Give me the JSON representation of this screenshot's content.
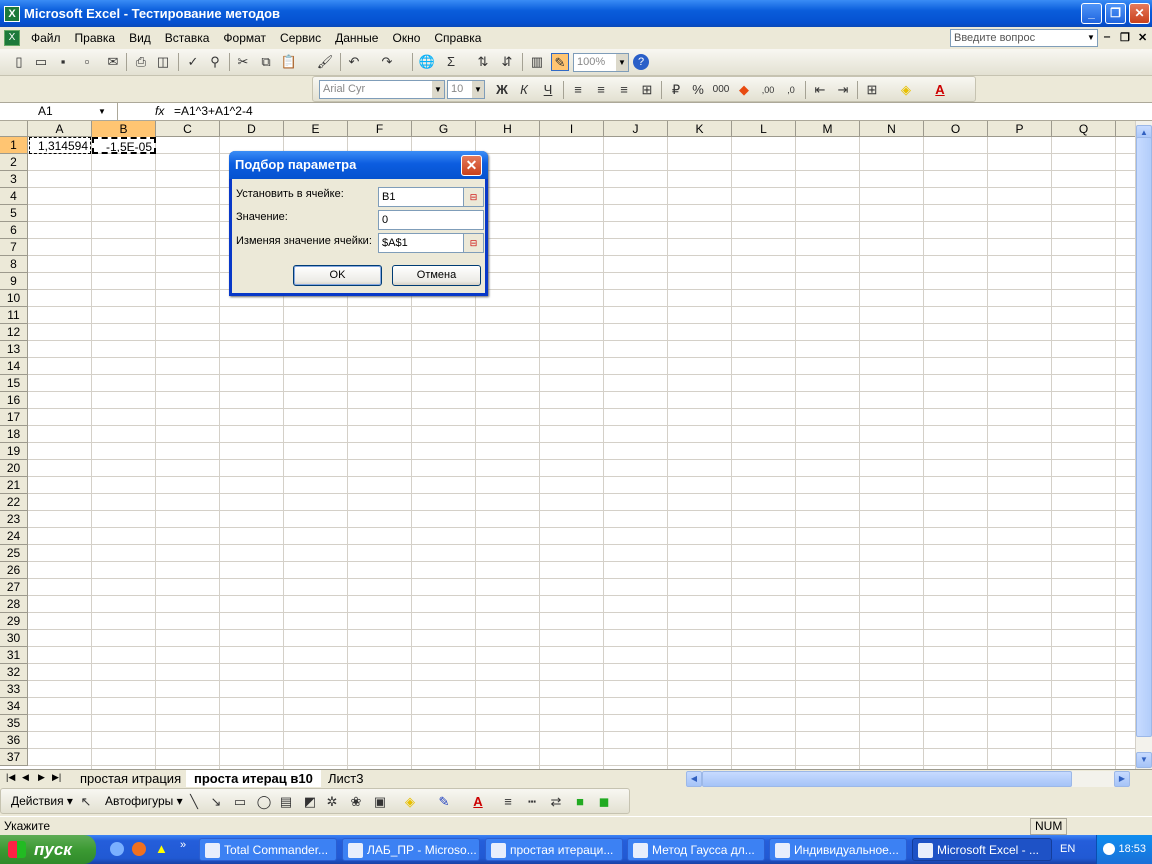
{
  "window": {
    "title": "Microsoft Excel - Тестирование методов"
  },
  "menu": {
    "items": [
      "Файл",
      "Правка",
      "Вид",
      "Вставка",
      "Формат",
      "Сервис",
      "Данные",
      "Окно",
      "Справка"
    ],
    "ask_placeholder": "Введите вопрос"
  },
  "toolbar": {
    "font": "Arial Cyr",
    "size": "10",
    "zoom": "100%"
  },
  "formula_bar": {
    "name_box": "A1",
    "fx": "fx",
    "formula": "=A1^3+A1^2-4"
  },
  "grid": {
    "columns": [
      "A",
      "B",
      "C",
      "D",
      "E",
      "F",
      "G",
      "H",
      "I",
      "J",
      "K",
      "L",
      "M",
      "N",
      "O",
      "P",
      "Q"
    ],
    "rows": [
      "1",
      "2",
      "3",
      "4",
      "5",
      "6",
      "7",
      "8",
      "9",
      "10",
      "11",
      "12",
      "13",
      "14",
      "15",
      "16",
      "17",
      "18",
      "19",
      "20",
      "21",
      "22",
      "23",
      "24",
      "25",
      "26",
      "27",
      "28",
      "29",
      "30",
      "31",
      "32",
      "33",
      "34",
      "35",
      "36",
      "37"
    ],
    "cells": {
      "A1": "1,314594",
      "B1": "-1,5E-05"
    }
  },
  "dialog": {
    "title": "Подбор параметра",
    "set_cell_label": "Установить в ячейке:",
    "set_cell_value": "B1",
    "value_label": "Значение:",
    "value_value": "0",
    "changing_label": "Изменяя значение ячейки:",
    "changing_value": "$A$1",
    "ok": "OK",
    "cancel": "Отмена"
  },
  "sheets": {
    "tab1": "простая итрация",
    "tab2": "проста итерац в10",
    "tab3": "Лист3"
  },
  "drawing": {
    "actions": "Действия",
    "autoshapes": "Автофигуры"
  },
  "status": {
    "text": "Укажите",
    "num": "NUM"
  },
  "taskbar": {
    "start": "пуск",
    "tasks": [
      "Total Commander...",
      "ЛАБ_ПР - Microso...",
      "простая итераци...",
      "Метод Гаусса дл...",
      "Индивидуальное...",
      "Microsoft Excel - ..."
    ],
    "lang": "EN",
    "time": "18:53"
  }
}
